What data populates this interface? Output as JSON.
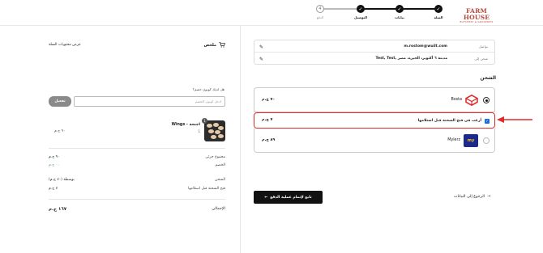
{
  "brand": {
    "name": "FARM HOUSE",
    "tagline": "BUTCHERY & GROCERIES"
  },
  "steps": [
    {
      "label": "السلة",
      "number": "1",
      "done": true
    },
    {
      "label": "بيانات",
      "number": "2",
      "done": true
    },
    {
      "label": "التوصيل",
      "number": "3",
      "done": true
    },
    {
      "label": "الدفع",
      "number": "4",
      "done": false
    }
  ],
  "summary": {
    "title": "ملخص",
    "toggle_label": "عرض محتويات السلة",
    "coupon_question": "هل لديك كوبون خصم؟",
    "coupon_placeholder": "ادخل كوبون الخصم",
    "coupon_button": "تفعيل",
    "product": {
      "name": "Wings - اجنحة",
      "quantity": "1",
      "price": "٩٠ ج.م",
      "badge": "1"
    },
    "rows": [
      {
        "label": "مجموع جزئي",
        "value": "٩٠ ج.م"
      },
      {
        "label": "الخصم",
        "value": "٠٠ ج.م"
      },
      {
        "label": "الشحن",
        "value": "بوسطة (٧٠ ج.م)"
      },
      {
        "label": "فتح الشحنة قبل استلامها",
        "value": "٧ ج.م"
      }
    ],
    "total_label": "الإجمالي",
    "total_value": "١٦٧ ج.م"
  },
  "contact": {
    "label": "تواصل",
    "value": "m.rostom@wuilt.com",
    "edit_icon": "pencil-icon"
  },
  "ship_to": {
    "label": "شحن إلى",
    "value": "Test, Test, مدينة ٦ أكتوبر، الجيزة، مصر",
    "edit_icon": "pencil-icon"
  },
  "shipping": {
    "section_title": "الشحن",
    "options": [
      {
        "carrier": "Bosta",
        "price": "٧٠ ج.م",
        "selected": true
      },
      {
        "carrier": "Mylerz",
        "price": "٨٩ ج.م",
        "selected": false,
        "logo_text": "my"
      }
    ],
    "open_before_receive": {
      "label": "أرغب في فتح الشحنة قبل استلامها",
      "price": "٧ ج.م",
      "checked": true
    }
  },
  "actions": {
    "continue_label": "تابع لإتمام عملية الدفع",
    "back_label": "الرجوع إلى البيانات"
  },
  "colors": {
    "accent_red": "#e12b2b",
    "brand": "#b5463b",
    "checkbox": "#1c6bd6",
    "button": "#111111"
  }
}
